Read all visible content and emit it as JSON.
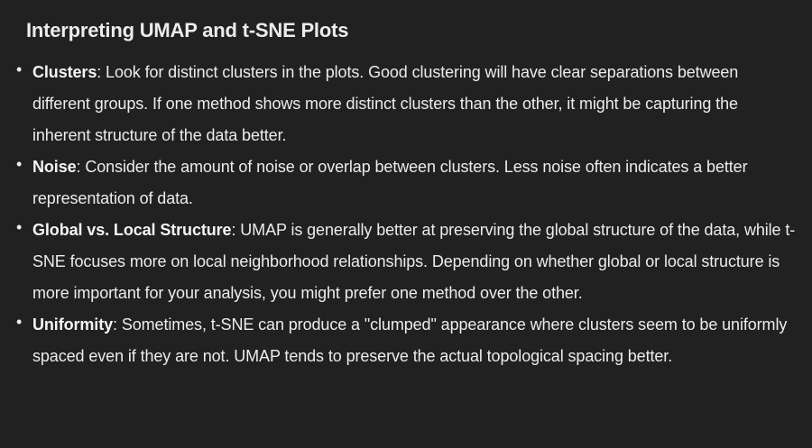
{
  "heading": "Interpreting UMAP and t-SNE Plots",
  "items": [
    {
      "bullet": "•",
      "term": "Clusters",
      "text": ": Look for distinct clusters in the plots. Good clustering will have clear separations between different groups. If one method shows more distinct clusters than the other, it might be capturing the inherent structure of the data better."
    },
    {
      "bullet": "•",
      "term": "Noise",
      "text": ": Consider the amount of noise or overlap between clusters. Less noise often indicates a better representation of data."
    },
    {
      "bullet": "•",
      "term": "Global vs. Local Structure",
      "text": ": UMAP is generally better at preserving the global structure of the data, while t-SNE focuses more on local neighborhood relationships. Depending on whether global or local structure is more important for your analysis, you might prefer one method over the other."
    },
    {
      "bullet": "•",
      "term": "Uniformity",
      "text": ": Sometimes, t-SNE can produce a \"clumped\" appearance where clusters seem to be uniformly spaced even if they are not. UMAP tends to preserve the actual topological spacing better."
    }
  ]
}
